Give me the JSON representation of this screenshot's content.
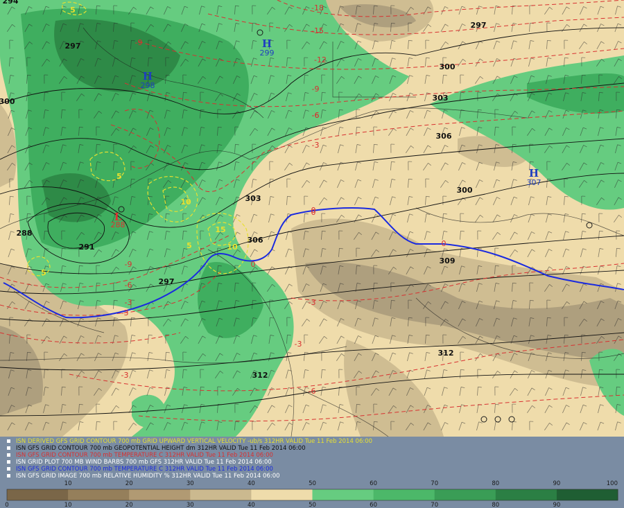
{
  "map": {
    "highs": [
      {
        "label": "H",
        "value": "298",
        "color": "#1f3fbf"
      },
      {
        "label": "H",
        "value": "299",
        "color": "#1f3fbf"
      },
      {
        "label": "H",
        "value": "307",
        "color": "#1f3fbf"
      }
    ],
    "lows": [
      {
        "label": "L",
        "value": "288",
        "color": "#e03030"
      }
    ],
    "height_labels": [
      "294",
      "297",
      "297",
      "300",
      "300",
      "303",
      "306",
      "300",
      "303",
      "306",
      "309",
      "312",
      "312",
      "291",
      "297",
      "288"
    ],
    "temp_labels": [
      "-18",
      "-15",
      "-12",
      "-9",
      "-9",
      "-6",
      "-3",
      "-3",
      "0",
      "-3",
      "-6",
      "-9",
      "-3",
      "0",
      "-3",
      "-6",
      "-3",
      "-6",
      "0",
      "0"
    ],
    "omega_labels": [
      "5",
      "5",
      "10",
      "15",
      "10",
      "5",
      "5"
    ],
    "colors": {
      "rh_30": "#a89a7a",
      "rh_40": "#cbb98f",
      "rh_50": "#efdcab",
      "rh_60": "#66cc80",
      "rh_70": "#3fae5f",
      "rh_80": "#2e8a47",
      "height_contour": "#101010",
      "temperature_contour": "#d83030",
      "zero_isotherm": "#1a2adf",
      "omega_contour": "#e8e030"
    }
  },
  "legend": {
    "lines": [
      {
        "text": "ISN DERIVED GFS GRID CONTOUR 700 mb GRID UPWARD VERTICAL VELOCITY -ub/s 312HR VALID Tue 11 Feb 2014 06:00",
        "color": "#e8e030"
      },
      {
        "text": "ISN GFS GRID CONTOUR 700 mb GEOPOTENTIAL HEIGHT dm 312HR VALID Tue 11 Feb 2014 06:00",
        "color": "#101010"
      },
      {
        "text": "ISN GFS GRID CONTOUR 700 mb TEMPERATURE C 312HR VALID Tue 11 Feb 2014 06:00",
        "color": "#d83030"
      },
      {
        "text": "ISN GRID PLOT 700 MB WIND BARBS 700 mb GFS 312HR VALID Tue 11 Feb 2014 06:00",
        "color": "#ffffff"
      },
      {
        "text": "ISN GFS GRID CONTOUR 700 mb TEMPERATURE C 312HR VALID Tue 11 Feb 2014 06:00",
        "color": "#1a2adf"
      },
      {
        "text": "ISN GFS GRID IMAGE 700 mb RELATIVE HUMIDITY % 312HR VALID Tue 11 Feb 2014 06:00",
        "color": "#ffffff"
      }
    ],
    "colorbar": {
      "top_ticks": [
        "10",
        "20",
        "30",
        "40",
        "50",
        "60",
        "70",
        "80",
        "90",
        "100"
      ],
      "bottom_ticks": [
        "0",
        "10",
        "20",
        "30",
        "40",
        "50",
        "60",
        "70",
        "80",
        "90"
      ],
      "bin_colors": [
        "#7a6648",
        "#957f5b",
        "#b19a73",
        "#cbb98f",
        "#efdcab",
        "#66cc80",
        "#4cb869",
        "#3a9d56",
        "#2b7f44",
        "#1f5e33"
      ]
    }
  }
}
